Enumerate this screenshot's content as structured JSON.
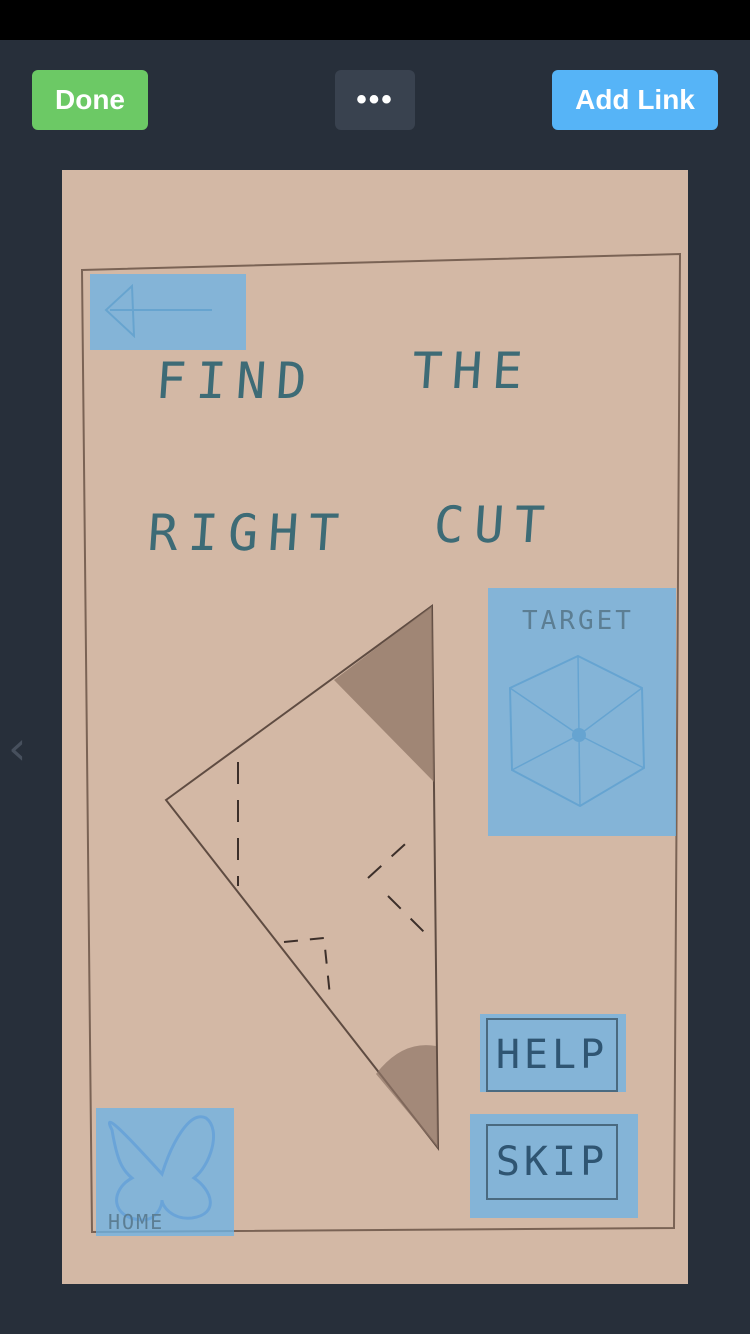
{
  "toolbar": {
    "done_label": "Done",
    "more_label": "•••",
    "add_link_label": "Add Link"
  },
  "nav": {
    "prev_glyph": "‹"
  },
  "sketch": {
    "title_line1_word1": "FIND",
    "title_line1_word2": "THE",
    "title_line2_word1": "RIGHT",
    "title_line2_word2": "CUT",
    "target_label": "TARGET",
    "help_label": "HELP",
    "skip_label": "SKIP",
    "home_label": "HOME",
    "back_arrow_glyph": "←"
  },
  "colors": {
    "done": "#6cc965",
    "add_link": "#56b4f7",
    "hotspot": "#6eb4e6",
    "paper": "#d3b8a5"
  }
}
